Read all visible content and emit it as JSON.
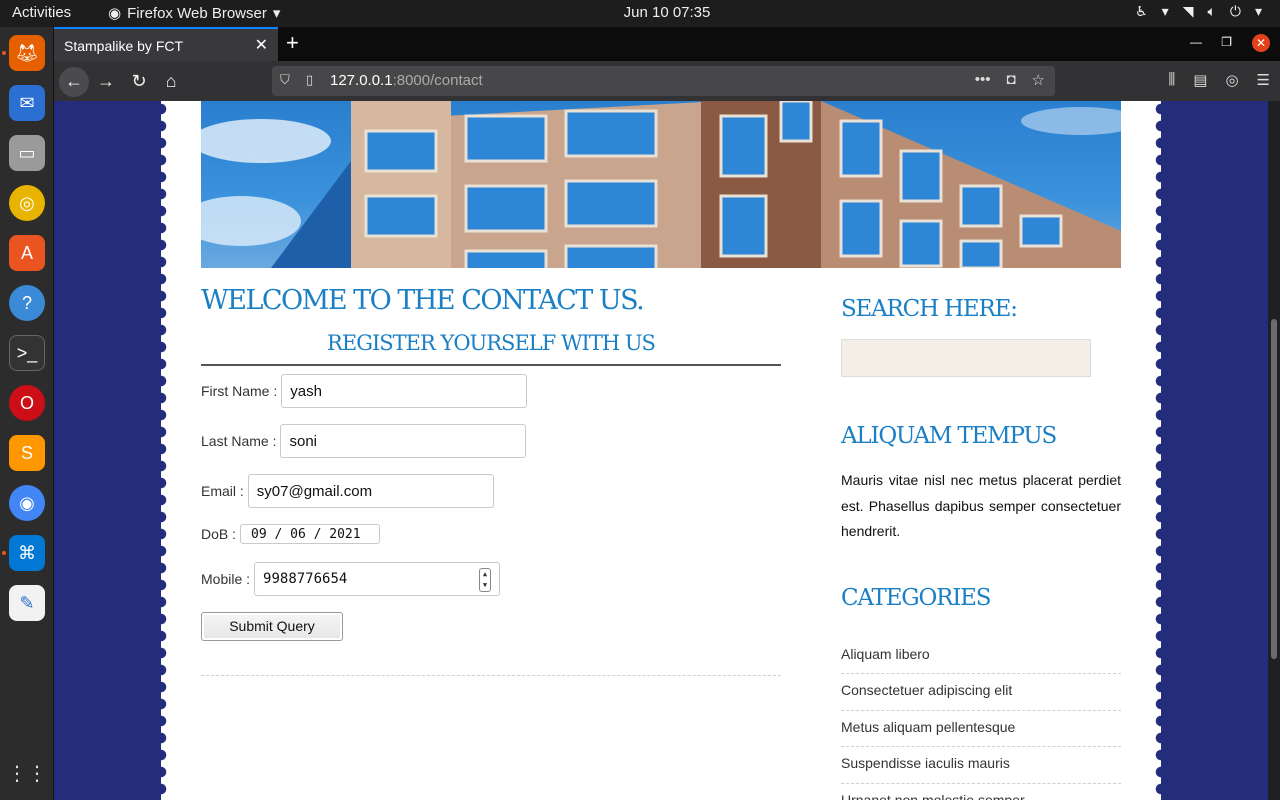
{
  "system": {
    "activities": "Activities",
    "app_name": "Firefox Web Browser",
    "clock": "Jun 10  07:35"
  },
  "browser": {
    "tab_title": "Stampalike by FCT",
    "url_host": "127.0.0.1",
    "url_rest": ":8000/contact"
  },
  "page": {
    "title": "WELCOME TO THE CONTACT US.",
    "subtitle": "REGISTER YOURSELF WITH US",
    "form": {
      "first_name_label": "First Name :",
      "first_name_value": "yash",
      "last_name_label": "Last Name :",
      "last_name_value": "soni",
      "email_label": "Email :",
      "email_value": "sy07@gmail.com",
      "dob_label": "DoB :",
      "dob_value": "09 / 06 / 2021",
      "mobile_label": "Mobile :",
      "mobile_value": "9988776654",
      "submit_label": "Submit Query"
    }
  },
  "sidebar": {
    "search_heading": "SEARCH HERE:",
    "tempus_heading": "ALIQUAM TEMPUS",
    "tempus_text": "Mauris vitae nisl nec metus placerat perdiet est. Phasellus dapibus semper consectetuer hendrerit.",
    "categories_heading": "CATEGORIES",
    "categories": [
      "Aliquam libero",
      "Consectetuer adipiscing elit",
      "Metus aliquam pellentesque",
      "Suspendisse iaculis mauris",
      "Urnanet non molestie semper"
    ]
  },
  "colors": {
    "accent": "#1a7fc4",
    "page_bg": "#232d7c"
  }
}
